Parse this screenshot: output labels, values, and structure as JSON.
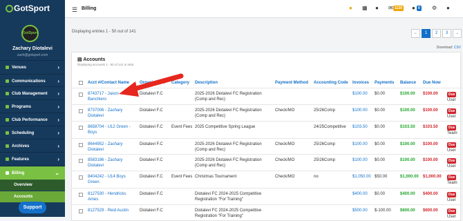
{
  "sidebar": {
    "logo": "GotSport",
    "avatar_text": "GotSport",
    "user_name": "Zachary Diotalevi",
    "user_email": "zach@gotsport.com",
    "items": [
      {
        "label": "Venues"
      },
      {
        "label": "Communications"
      },
      {
        "label": "Club Management"
      },
      {
        "label": "Programs"
      },
      {
        "label": "Club Performance"
      },
      {
        "label": "Scheduling"
      },
      {
        "label": "Archives"
      },
      {
        "label": "Features"
      },
      {
        "label": "Billing"
      }
    ],
    "subitems": [
      {
        "label": "Overview"
      },
      {
        "label": "Accounts"
      }
    ],
    "support": "Support"
  },
  "header": {
    "title": "Billing",
    "badge_mail": "1139",
    "badge_notif": "0"
  },
  "main": {
    "displaying": "Displaying entries 1 - 50 out of 141",
    "pages": [
      "←",
      "1",
      "2",
      "3",
      "→"
    ],
    "download_label": "Download:",
    "download_link": "CSV",
    "panel_title": "Accounts",
    "panel_sub": "Displaying accounts 1 - 50 of 141 in total",
    "columns": [
      "Acct #/Contact Name",
      "Organization",
      "Category",
      "Description",
      "Payment Method",
      "Accounting Code",
      "Invoices",
      "Payments",
      "Balance",
      "Due Now"
    ],
    "rows": [
      {
        "acct": "8743717 - Jaxon Banchiero",
        "org": "Diotalevi F.C",
        "cat": "",
        "desc": "2025-2026 Diotalevi FC Registration (Comp and Rec)",
        "pm": "",
        "code": "",
        "inv": "$100.00",
        "pay": "$0.00",
        "bal": "$100.00",
        "due": "$100.00",
        "type": "User"
      },
      {
        "acct": "8737006 - Zachary Diotalevi",
        "org": "Diotalevi F.C",
        "cat": "",
        "desc": "2025-2026 Diotalevi FC Registration (Comp and Rec)",
        "pm": "Check/MO",
        "code": "25/26Comp",
        "inv": "$100.00",
        "pay": "$0.00",
        "bal": "$100.00",
        "due": "$100.00",
        "type": "User"
      },
      {
        "acct": "8658704 - U12 Green - Boys",
        "org": "Diotalevi F.C",
        "cat": "Event Fees",
        "desc": "2025 Competitive Spring League",
        "pm": "",
        "code": "24/25Competitive",
        "inv": "$103.50",
        "pay": "$0.00",
        "bal": "$103.50",
        "due": "$103.50",
        "type": "Team"
      },
      {
        "acct": "8644952 - Zachary Diotalevi",
        "org": "Diotalevi F.C",
        "cat": "",
        "desc": "2025-2026 Diotalevi FC Registration (Comp and Rec)",
        "pm": "Check/MO",
        "code": "25/26Comp",
        "inv": "$100.00",
        "pay": "$0.00",
        "bal": "$100.00",
        "due": "$100.00",
        "type": "User"
      },
      {
        "acct": "8583186 - Zachary Diotalevi",
        "org": "Diotalevi F.C",
        "cat": "",
        "desc": "2025-2026 Diotalevi FC Registration (Comp and Rec)",
        "pm": "Check/MO",
        "code": "25/26Comp",
        "inv": "$100.00",
        "pay": "$0.00",
        "bal": "$100.00",
        "due": "$100.00",
        "type": "User"
      },
      {
        "acct": "8404242 - U14 Boys Green",
        "org": "Diotalevi F.C",
        "cat": "Event Fees",
        "desc": "Christmas Tournament",
        "pm": "Check/MO",
        "code": "no",
        "inv": "$1,050.00",
        "pay": "$50.00",
        "bal": "$1,000.00",
        "due": "$1,000.00",
        "type": "Team"
      },
      {
        "acct": "8127530 - Hendricks Ames",
        "org": "Diotalevi F.C",
        "cat": "",
        "desc": "Diotalevi FC 2024-2025 Competitive Registration \"For Training\"",
        "pm": "",
        "code": "",
        "inv": "$400.00",
        "pay": "$0.00",
        "bal": "$400.00",
        "due": "$400.00",
        "type": "User"
      },
      {
        "acct": "8127529 - Reid Austin",
        "org": "Diotalevi F.C",
        "cat": "",
        "desc": "Diotalevi FC 2024-2025 Competitive Registration \"For Training\"",
        "pm": "",
        "code": "",
        "inv": "$500.00",
        "pay": "$-100.00",
        "bal": "$600.00",
        "due": "$600.00",
        "type": "User"
      }
    ]
  },
  "colors": {
    "sidebar": "#163a5c",
    "accent": "#7ac143",
    "link": "#1470c8",
    "danger": "#d0242b",
    "due_badge": "#d0242b"
  }
}
